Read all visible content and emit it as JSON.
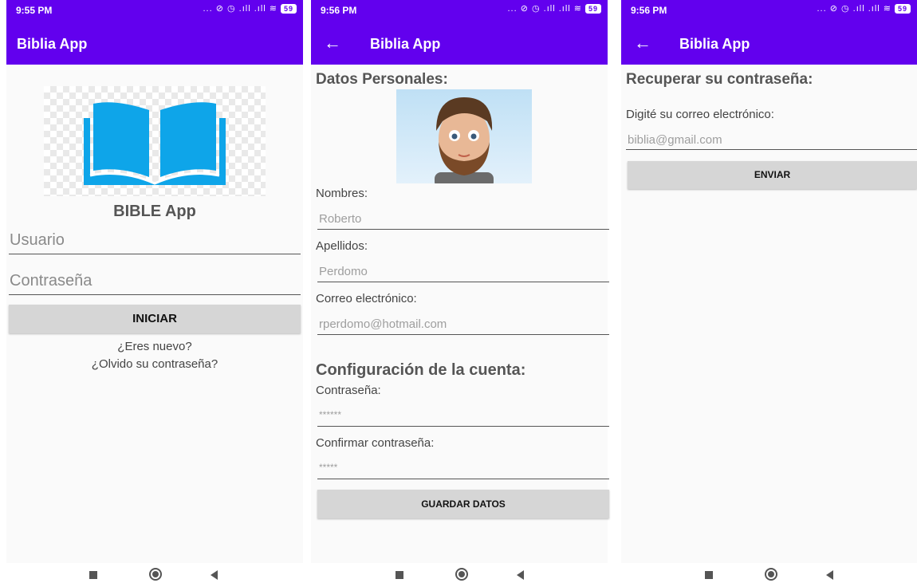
{
  "screens": [
    {
      "status_time": "9:55 PM",
      "status_icons": "... ⊘ ◷ .ıll .ıll ≋",
      "battery": "59",
      "app_title": "Biblia App",
      "brand_title": "BIBLE App",
      "username_placeholder": "Usuario",
      "password_placeholder": "Contraseña",
      "login_button": "INICIAR",
      "new_user_link": "¿Eres nuevo?",
      "forgot_link": "¿Olvido su contraseña?"
    },
    {
      "status_time": "9:56 PM",
      "status_icons": "... ⊘ ◷ .ıll .ıll ≋",
      "battery": "59",
      "back_icon": "←",
      "app_title": "Biblia App",
      "section_personal": "Datos Personales:",
      "first_name_label": "Nombres:",
      "first_name_value": "Roberto",
      "last_name_label": "Apellidos:",
      "last_name_value": "Perdomo",
      "email_label": "Correo electrónico:",
      "email_value": "rperdomo@hotmail.com",
      "section_account": "Configuración de la cuenta:",
      "password_label": "Contraseña:",
      "password_value": "******",
      "confirm_label": "Confirmar contraseña:",
      "confirm_value": "*****",
      "save_button": "GUARDAR DATOS"
    },
    {
      "status_time": "9:56 PM",
      "status_icons": "... ⊘ ◷ .ıll .ıll ≋",
      "battery": "59",
      "back_icon": "←",
      "app_title": "Biblia App",
      "heading": "Recuperar su contraseña:",
      "email_prompt": "Digité su correo electrónico:",
      "email_placeholder": "biblia@gmail.com",
      "send_button": "ENVIAR"
    }
  ],
  "colors": {
    "primary": "#6200ee",
    "book_blue": "#0ea5e9",
    "button_gray": "#d6d6d6"
  }
}
